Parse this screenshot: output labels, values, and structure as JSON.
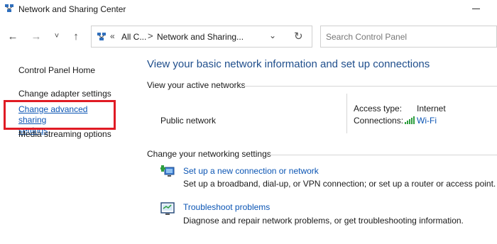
{
  "window": {
    "title": "Network and Sharing Center"
  },
  "address": {
    "crumbs_prefix": "«",
    "crumb1": "All C...",
    "crumb_sep": ">",
    "crumb2": "Network and Sharing...",
    "search_placeholder": "Search Control Panel"
  },
  "nav": {
    "back": "←",
    "forward": "→",
    "recent": "˅",
    "up": "↑",
    "dropdown": "⌄",
    "refresh": "↻"
  },
  "sidebar": {
    "home": "Control Panel Home",
    "adapter": "Change adapter settings",
    "advanced_line1": "Change advanced sharing",
    "advanced_line2": "settings",
    "media": "Media streaming options"
  },
  "main": {
    "title": "View your basic network information and set up connections",
    "active_label": "View your active networks",
    "network_name": "Public network",
    "access_type_label": "Access type:",
    "access_type_value": "Internet",
    "connections_label": "Connections:",
    "connections_value": "Wi-Fi",
    "change_label": "Change your networking settings",
    "tasks": [
      {
        "link": "Set up a new connection or network",
        "desc": "Set up a broadband, dial-up, or VPN connection; or set up a router or access point."
      },
      {
        "link": "Troubleshoot problems",
        "desc": "Diagnose and repair network problems, or get troubleshooting information."
      }
    ]
  },
  "colors": {
    "link": "#0b55b4",
    "heading": "#1f4e8c",
    "highlight": "#e01b24"
  },
  "icons": [
    "network-center-icon",
    "minimize-icon",
    "back-arrow-icon",
    "forward-arrow-icon",
    "recent-locations-icon",
    "up-arrow-icon",
    "control-panel-icon",
    "address-dropdown-icon",
    "refresh-icon",
    "wifi-signal-icon",
    "new-connection-icon",
    "troubleshoot-icon"
  ]
}
